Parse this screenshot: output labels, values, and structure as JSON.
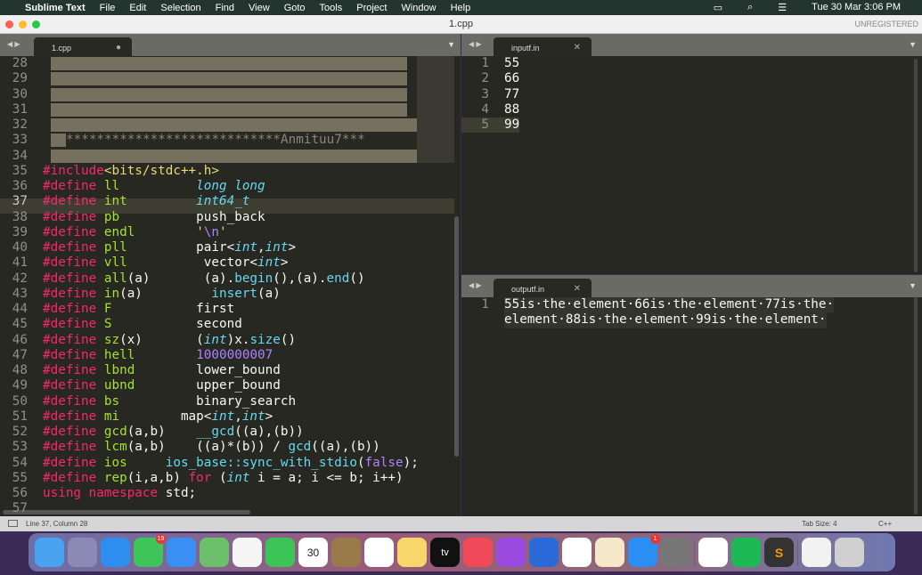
{
  "menubar": {
    "app": "Sublime Text",
    "items": [
      "File",
      "Edit",
      "Selection",
      "Find",
      "View",
      "Goto",
      "Tools",
      "Project",
      "Window",
      "Help"
    ],
    "datetime": "Tue 30 Mar  3:06 PM"
  },
  "window": {
    "title": "1.cpp",
    "unregistered": "UNREGISTERED"
  },
  "left_tab": {
    "label": "1.cpp",
    "modified_icon": "dot-icon"
  },
  "left_code": {
    "selected_lines": [
      28,
      29,
      30,
      31,
      32,
      33,
      34
    ],
    "line33_text": "****************************Anmituu7***",
    "lines": [
      [
        35,
        [
          [
            "#include",
            "k"
          ],
          [
            "<bits/stdc++.h>",
            "s"
          ]
        ]
      ],
      [
        36,
        [
          [
            "#define ",
            "k"
          ],
          [
            "ll",
            "g"
          ],
          [
            "          ",
            "w"
          ],
          [
            "long long",
            "t"
          ]
        ]
      ],
      [
        37,
        [
          [
            "#define ",
            "k"
          ],
          [
            "int",
            "g"
          ],
          [
            "         ",
            "w"
          ],
          [
            "int64_t",
            "t"
          ]
        ]
      ],
      [
        38,
        [
          [
            "#define ",
            "k"
          ],
          [
            "pb",
            "g"
          ],
          [
            "          push_back",
            "w"
          ]
        ]
      ],
      [
        39,
        [
          [
            "#define ",
            "k"
          ],
          [
            "endl",
            "g"
          ],
          [
            "        ",
            "w"
          ],
          [
            "'",
            "s"
          ],
          [
            "\\n",
            "n"
          ],
          [
            "'",
            "s"
          ]
        ]
      ],
      [
        40,
        [
          [
            "#define ",
            "k"
          ],
          [
            "pll",
            "g"
          ],
          [
            "         pair<",
            "w"
          ],
          [
            "int",
            "t"
          ],
          [
            ",",
            "w"
          ],
          [
            "int",
            "t"
          ],
          [
            ">",
            "w"
          ]
        ]
      ],
      [
        41,
        [
          [
            "#define ",
            "k"
          ],
          [
            "vll",
            "g"
          ],
          [
            "          vector<",
            "w"
          ],
          [
            "int",
            "t"
          ],
          [
            ">",
            "w"
          ]
        ]
      ],
      [
        42,
        [
          [
            "#define ",
            "k"
          ],
          [
            "all",
            "g"
          ],
          [
            "(a)       (a).",
            "w"
          ],
          [
            "begin",
            "f"
          ],
          [
            "(),(a).",
            "w"
          ],
          [
            "end",
            "f"
          ],
          [
            "()",
            "w"
          ]
        ]
      ],
      [
        43,
        [
          [
            "#define ",
            "k"
          ],
          [
            "in",
            "g"
          ],
          [
            "(a)         ",
            "w"
          ],
          [
            "insert",
            "f"
          ],
          [
            "(a)",
            "w"
          ]
        ]
      ],
      [
        44,
        [
          [
            "#define ",
            "k"
          ],
          [
            "F",
            "g"
          ],
          [
            "           first",
            "w"
          ]
        ]
      ],
      [
        45,
        [
          [
            "#define ",
            "k"
          ],
          [
            "S",
            "g"
          ],
          [
            "           second",
            "w"
          ]
        ]
      ],
      [
        46,
        [
          [
            "#define ",
            "k"
          ],
          [
            "sz",
            "g"
          ],
          [
            "(x)       (",
            "w"
          ],
          [
            "int",
            "t"
          ],
          [
            ")x.",
            "w"
          ],
          [
            "size",
            "f"
          ],
          [
            "()",
            "w"
          ]
        ]
      ],
      [
        47,
        [
          [
            "#define ",
            "k"
          ],
          [
            "hell",
            "g"
          ],
          [
            "        ",
            "w"
          ],
          [
            "1000000007",
            "n"
          ]
        ]
      ],
      [
        48,
        [
          [
            "#define ",
            "k"
          ],
          [
            "lbnd",
            "g"
          ],
          [
            "        lower_bound",
            "w"
          ]
        ]
      ],
      [
        49,
        [
          [
            "#define ",
            "k"
          ],
          [
            "ubnd",
            "g"
          ],
          [
            "        upper_bound",
            "w"
          ]
        ]
      ],
      [
        50,
        [
          [
            "#define ",
            "k"
          ],
          [
            "bs",
            "g"
          ],
          [
            "          binary_search",
            "w"
          ]
        ]
      ],
      [
        51,
        [
          [
            "#define ",
            "k"
          ],
          [
            "mi",
            "g"
          ],
          [
            "        map<",
            "w"
          ],
          [
            "int",
            "t"
          ],
          [
            ",",
            "w"
          ],
          [
            "int",
            "t"
          ],
          [
            ">",
            "w"
          ]
        ]
      ],
      [
        52,
        [
          [
            "#define ",
            "k"
          ],
          [
            "gcd",
            "g"
          ],
          [
            "(a,b)    ",
            "w"
          ],
          [
            "__gcd",
            "f"
          ],
          [
            "((a),(b))",
            "w"
          ]
        ]
      ],
      [
        53,
        [
          [
            "#define ",
            "k"
          ],
          [
            "lcm",
            "g"
          ],
          [
            "(a,b)    ((a)*(b)) / ",
            "w"
          ],
          [
            "gcd",
            "f"
          ],
          [
            "((a),(b))",
            "w"
          ]
        ]
      ],
      [
        54,
        [
          [
            "#define ",
            "k"
          ],
          [
            "ios",
            "g"
          ],
          [
            "     ",
            "w"
          ],
          [
            "ios_base::sync_with_stdio",
            "f"
          ],
          [
            "(",
            "w"
          ],
          [
            "false",
            "n"
          ],
          [
            ");",
            "w"
          ]
        ]
      ],
      [
        55,
        [
          [
            "#define ",
            "k"
          ],
          [
            "rep",
            "g"
          ],
          [
            "(i,a,b) ",
            "w"
          ],
          [
            "for",
            "k"
          ],
          [
            " (",
            "w"
          ],
          [
            "int",
            "t"
          ],
          [
            " i = a; i <= b; i++)",
            "w"
          ]
        ]
      ],
      [
        56,
        [
          [
            "using ",
            "k"
          ],
          [
            "namespace ",
            "k"
          ],
          [
            "std;",
            "w"
          ]
        ]
      ],
      [
        57,
        []
      ]
    ]
  },
  "input_tab": {
    "label": "inputf.in",
    "close_icon": "close-icon"
  },
  "input_lines": [
    "55",
    "66",
    "77",
    "88",
    "99"
  ],
  "output_tab": {
    "label": "outputf.in",
    "close_icon": "close-icon"
  },
  "output_lines": [
    "55is·the·element·66is·the·element·77is·the·",
    "element·88is·the·element·99is·the·element·"
  ],
  "status": {
    "position": "Line 37, Column 28",
    "tab_size": "Tab Size: 4",
    "syntax": "C++"
  },
  "dock": {
    "apps": [
      "Finder",
      "Launchpad",
      "Safari",
      "Messages",
      "Mail",
      "Maps",
      "Photos",
      "FaceTime",
      "Calendar",
      "Contacts",
      "Reminders",
      "Notes",
      "TV",
      "Music",
      "Podcasts",
      "Keynote",
      "Numbers",
      "Pages",
      "App Store",
      "System Preferences",
      "Chrome",
      "Spotify",
      "Sublime Text",
      "Document",
      "Trash"
    ],
    "messages_badge": "19",
    "appstore_badge": "1",
    "calendar_month": "MAR",
    "calendar_day": "30",
    "tv_label": "tv"
  }
}
